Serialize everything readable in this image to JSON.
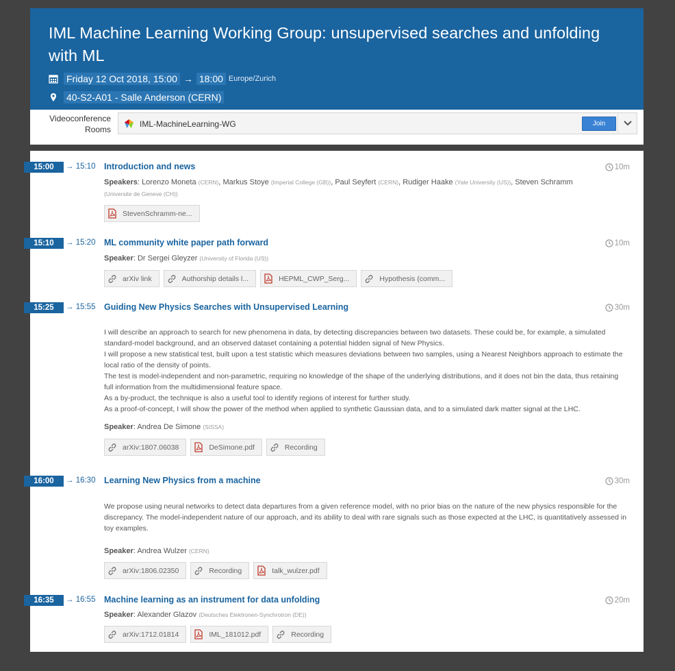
{
  "event": {
    "title": "IML Machine Learning Working Group: unsupervised searches and unfolding with ML",
    "date_start": "Friday 12 Oct 2018, 15:00",
    "arrow": "→",
    "date_end": "18:00",
    "timezone": "Europe/Zurich",
    "location": "40-S2-A01 - Salle Anderson (CERN)"
  },
  "videoconference": {
    "label_line1": "Videoconference",
    "label_line2": "Rooms",
    "room_name": "IML-MachineLearning-WG",
    "join_label": "Join"
  },
  "colors": {
    "accent": "#1a64a0",
    "background": "#424242",
    "pdf_red": "#c0392b"
  },
  "entries": [
    {
      "start": "15:00",
      "end": "→ 15:10",
      "title": "Introduction and news",
      "duration": "10m",
      "speaker_label": "Speakers",
      "speakers_html_parts": [
        {
          "name": "Lorenzo Moneta",
          "aff": "(CERN)"
        },
        {
          "name": "Markus Stoye",
          "aff": "(Imperial College (GB))"
        },
        {
          "name": "Paul Seyfert",
          "aff": "(CERN)"
        },
        {
          "name": "Rudiger Haake",
          "aff": "(Yale University (US))"
        },
        {
          "name": "Steven Schramm",
          "aff": "(Universite de Geneve (CH))"
        }
      ],
      "attachments": [
        {
          "type": "pdf",
          "label": "StevenSchramm-ne..."
        }
      ]
    },
    {
      "start": "15:10",
      "end": "→ 15:20",
      "title": "ML community white paper path forward",
      "duration": "10m",
      "speaker_label": "Speaker",
      "speakers_html_parts": [
        {
          "name": "Dr Sergei Gleyzer",
          "aff": "(University of Florida (US))"
        }
      ],
      "attachments": [
        {
          "type": "link",
          "label": "arXiv link"
        },
        {
          "type": "link",
          "label": "Authorship details l..."
        },
        {
          "type": "pdf",
          "label": "HEPML_CWP_Serg..."
        },
        {
          "type": "link",
          "label": "Hypothesis (comm..."
        }
      ]
    },
    {
      "start": "15:25",
      "end": "→ 15:55",
      "title": "Guiding New Physics Searches with Unsupervised Learning",
      "duration": "30m",
      "abstract": [
        "I will describe an approach to search for new phenomena in data, by detecting discrepancies between two datasets. These could be, for example, a simulated standard-model background, and an observed dataset containing a potential hidden signal of New Physics.",
        "I will propose a new statistical test, built upon a test statistic which measures deviations between two samples, using a Nearest Neighbors approach to estimate the local ratio of the density of points.",
        "The test is model-independent and non-parametric, requiring no knowledge of the shape of the underlying distributions, and it does not bin the data, thus retaining full information from the multidimensional feature space.",
        "As a by-product, the technique is also a useful tool to identify regions of interest for further study.",
        "As a proof-of-concept, I will show the power of the method when applied to synthetic Gaussian data, and to a simulated dark matter signal at the LHC."
      ],
      "speaker_label": "Speaker",
      "speakers_html_parts": [
        {
          "name": "Andrea De Simone",
          "aff": "(SISSA)"
        }
      ],
      "attachments": [
        {
          "type": "link",
          "label": "arXiv:1807.06038"
        },
        {
          "type": "pdf",
          "label": "DeSimone.pdf"
        },
        {
          "type": "link",
          "label": "Recording"
        }
      ]
    },
    {
      "start": "16:00",
      "end": "→ 16:30",
      "title": "Learning New Physics from a machine",
      "duration": "30m",
      "abstract": [
        "We propose using neural networks to detect data departures from a given reference model, with no prior bias on the nature of the new physics responsible for the discrepancy. The model-independent nature of our approach, and its ability to deal with rare signals such as those expected at the LHC, is quantitatively assessed in toy examples."
      ],
      "speaker_label": "Speaker",
      "speakers_html_parts": [
        {
          "name": "Andrea Wulzer",
          "aff": "(CERN)"
        }
      ],
      "attachments": [
        {
          "type": "link",
          "label": "arXiv:1806.02350"
        },
        {
          "type": "link",
          "label": "Recording"
        },
        {
          "type": "pdf",
          "label": "talk_wulzer.pdf"
        }
      ]
    },
    {
      "start": "16:35",
      "end": "→ 16:55",
      "title": "Machine learning as an instrument for data unfolding",
      "duration": "20m",
      "speaker_label": "Speaker",
      "speakers_html_parts": [
        {
          "name": "Alexander Glazov",
          "aff": "(Deutsches Elektronen-Synchrotron (DE))"
        }
      ],
      "attachments": [
        {
          "type": "link",
          "label": "arXiv:1712.01814"
        },
        {
          "type": "pdf",
          "label": "IML_181012.pdf"
        },
        {
          "type": "link",
          "label": "Recording"
        }
      ]
    }
  ]
}
